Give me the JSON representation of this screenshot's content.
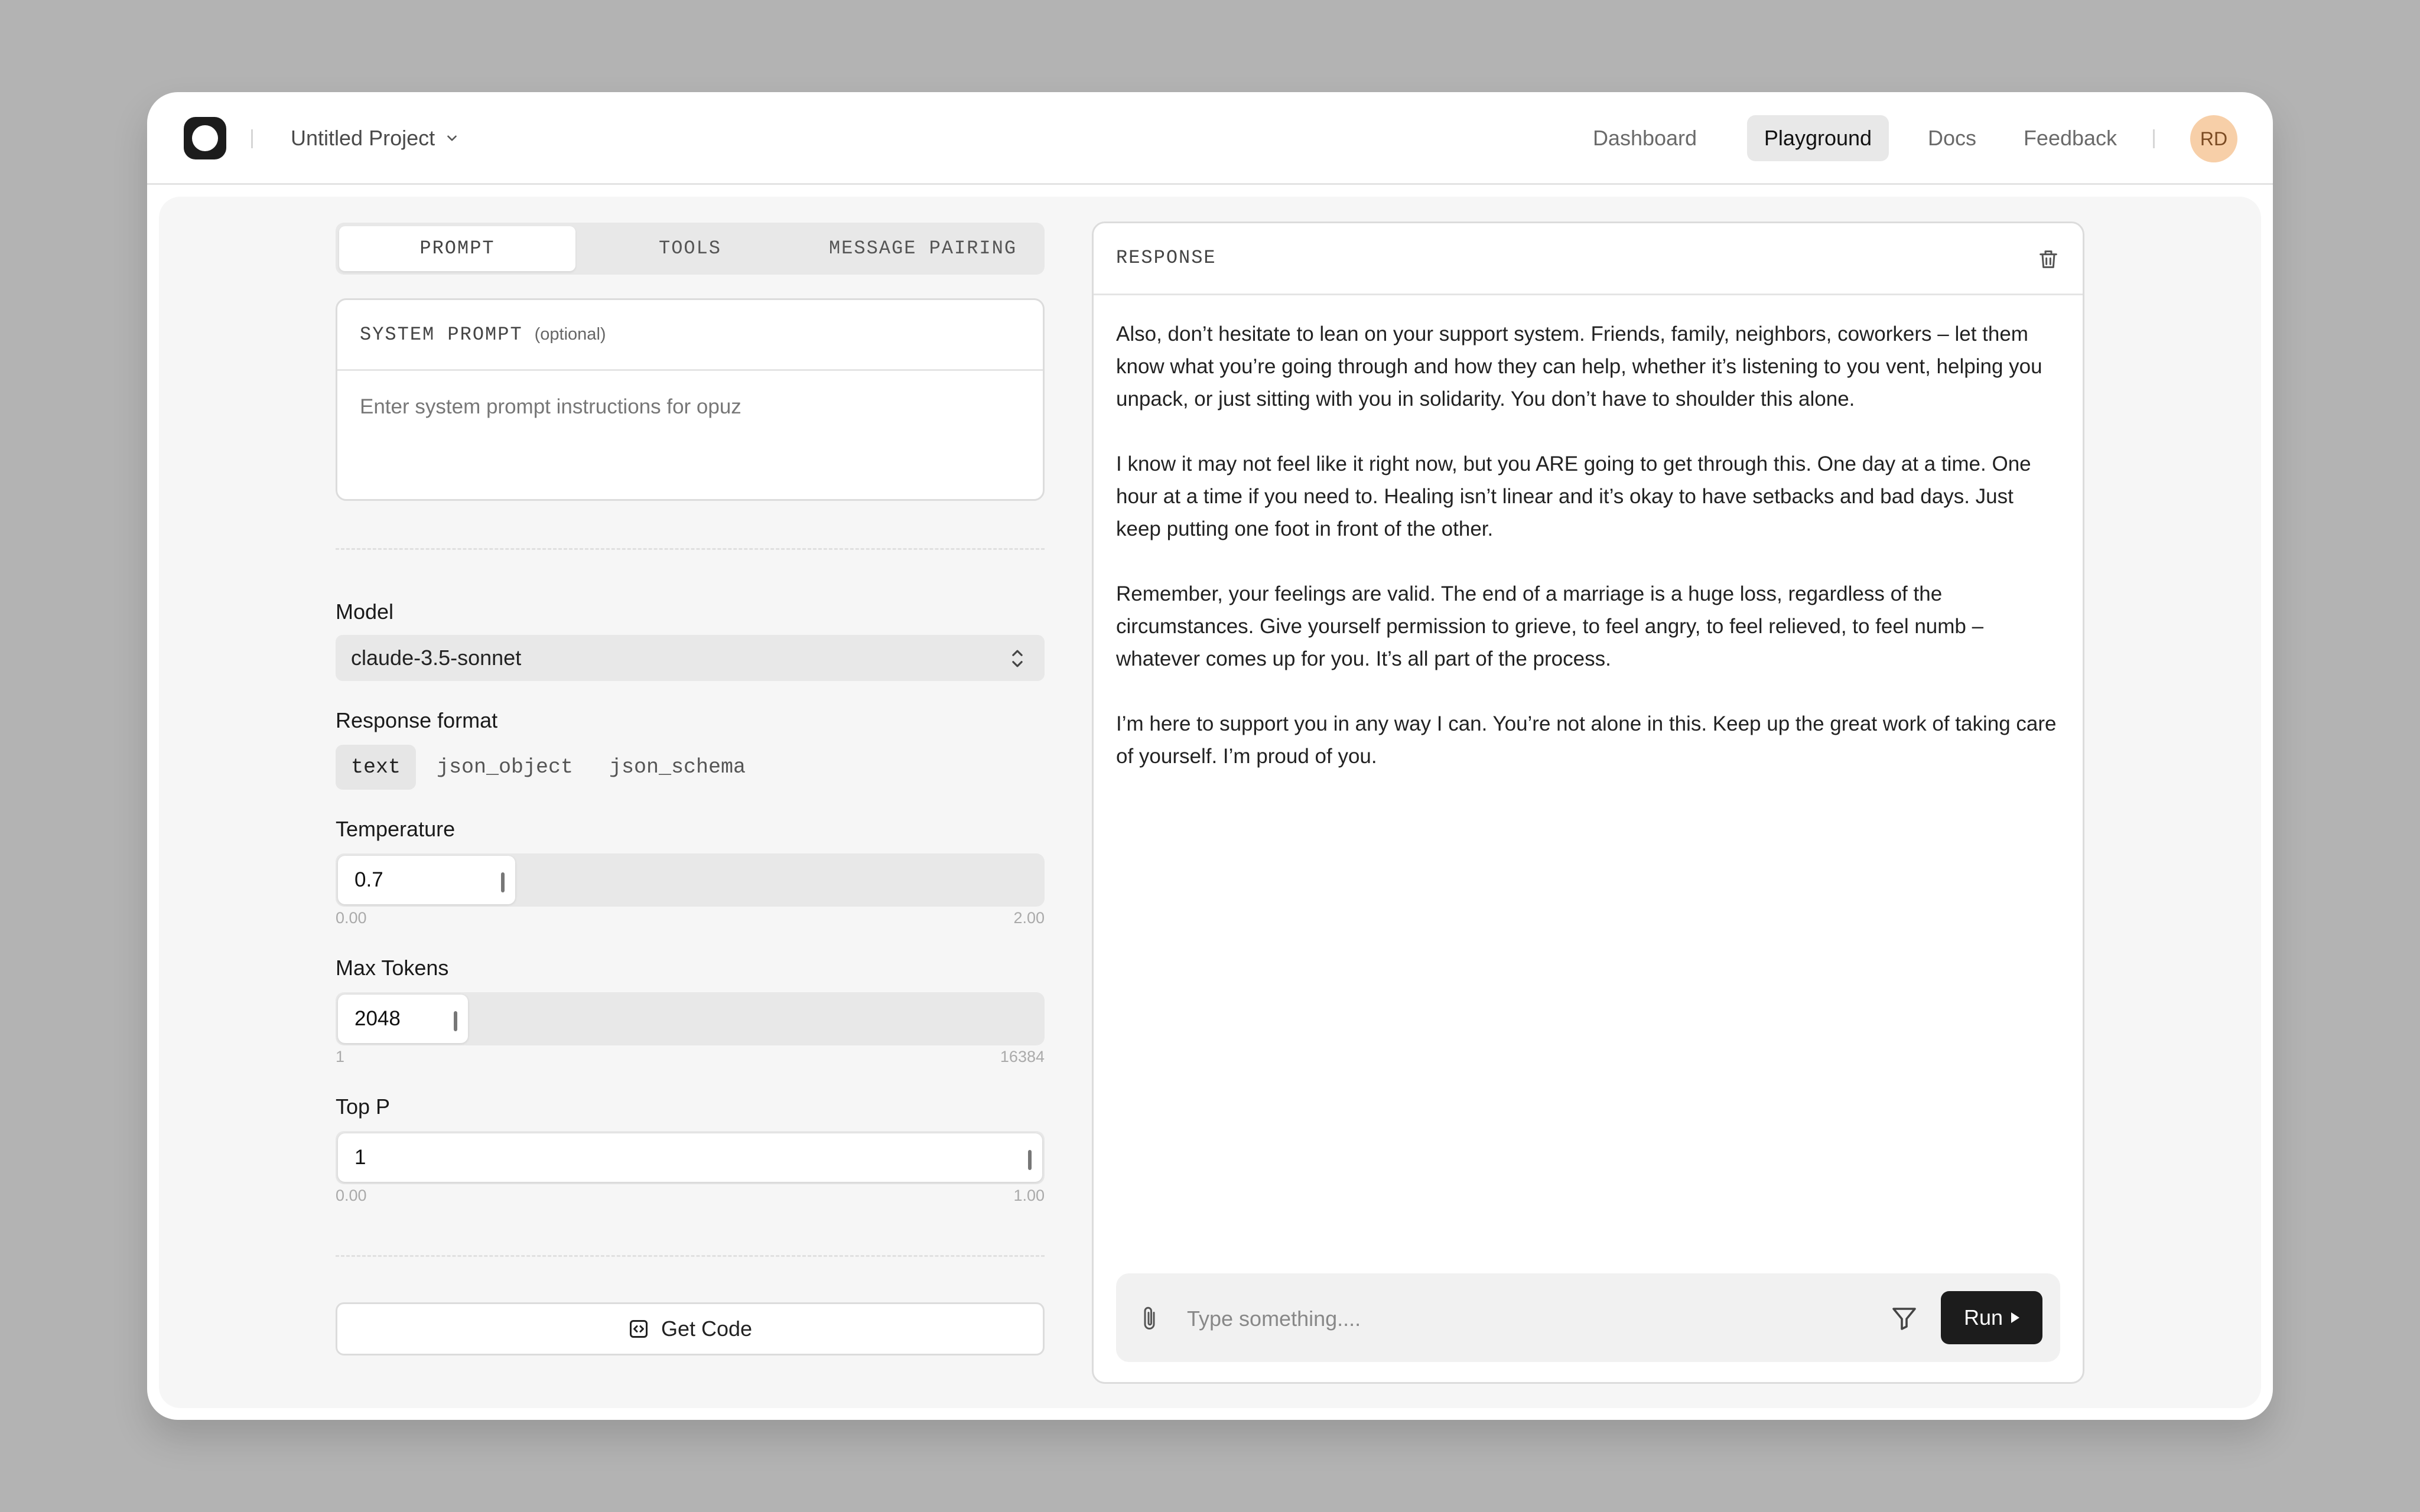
{
  "header": {
    "project_name": "Untitled Project",
    "nav": [
      "Dashboard",
      "Playground",
      "Docs",
      "Feedback"
    ],
    "active_nav": "Playground",
    "avatar_initials": "RD"
  },
  "tabs": [
    "PROMPT",
    "TOOLS",
    "MESSAGE PAIRING"
  ],
  "active_tab": "PROMPT",
  "system_prompt": {
    "title": "SYSTEM PROMPT",
    "optional": "(optional)",
    "placeholder": "Enter system prompt instructions for opuz"
  },
  "settings": {
    "model_label": "Model",
    "model_value": "claude-3.5-sonnet",
    "response_format_label": "Response format",
    "response_formats": [
      "text",
      "json_object",
      "json_schema"
    ],
    "active_format": "text",
    "temperature": {
      "label": "Temperature",
      "value": "0.7",
      "min": "0.00",
      "max": "2.00",
      "fraction": 0.35
    },
    "max_tokens": {
      "label": "Max Tokens",
      "value": "2048",
      "min": "1",
      "max": "16384",
      "fraction": 0.125
    },
    "top_p": {
      "label": "Top P",
      "value": "1",
      "min": "0.00",
      "max": "1.00",
      "fraction": 1.0
    },
    "get_code_label": "Get Code"
  },
  "response": {
    "title": "RESPONSE",
    "paragraphs": [
      "Also, don’t hesitate to lean on your support system. Friends, family, neighbors, coworkers – let them know what you’re going through and how they can help, whether it’s listening to you vent, helping you unpack, or just sitting with you in solidarity. You don’t have to shoulder this alone.",
      "I know it may not feel like it right now, but you ARE going to get through this. One day at a time. One hour at a time if you need to. Healing isn’t linear and it’s okay to have setbacks and bad days. Just keep putting one foot in front of the other.",
      "Remember, your feelings are valid. The end of a marriage is a huge loss, regardless of the circumstances. Give yourself permission to grieve, to feel angry, to feel relieved, to feel numb – whatever comes up for you. It’s all part of the process.",
      "I’m here to support you in any way I can. You’re not alone in this. Keep up the great work of taking care of yourself. I’m proud of you."
    ]
  },
  "composer": {
    "placeholder": "Type something....",
    "run_label": "Run"
  },
  "colors": {
    "background": "#b3b3b3",
    "panel": "#f6f6f6",
    "accent_dark": "#1c1c1c",
    "avatar_bg": "#f7cfa8"
  },
  "icons": [
    "app-logo-icon",
    "chevron-down-icon",
    "chevron-up-down-icon",
    "trash-icon",
    "code-icon",
    "paperclip-icon",
    "filter-icon",
    "play-icon"
  ]
}
